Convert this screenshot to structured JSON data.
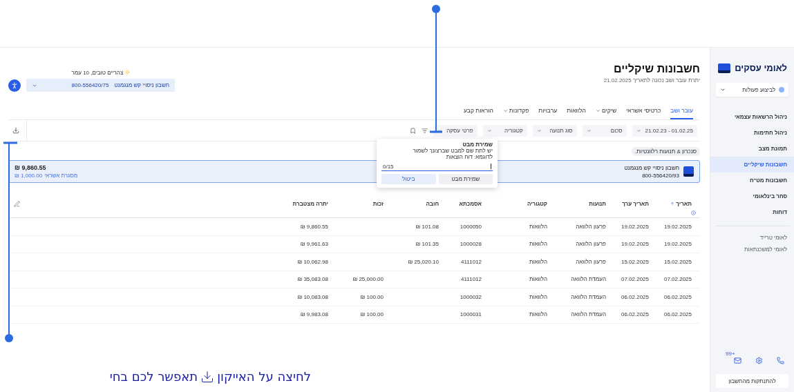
{
  "header": {
    "title": "חשבונות שיקליים",
    "subtitle": "יתרת עובר ושב נכונה לתאריך 21.02.2025",
    "greeting": "צהריים טובים, 10 עמר",
    "account_name": "חשבון ניסויי קש מנגמנט",
    "account_number": "800-556420/75"
  },
  "tabs": [
    {
      "label": "עובר ושב",
      "selected": true,
      "dropdown": false
    },
    {
      "label": "כרטיסי אשראי",
      "selected": false,
      "dropdown": false
    },
    {
      "label": "שיקים",
      "selected": false,
      "dropdown": true
    },
    {
      "label": "הלוואות",
      "selected": false,
      "dropdown": false
    },
    {
      "label": "ערבויות",
      "selected": false,
      "dropdown": false
    },
    {
      "label": "פקדונות",
      "selected": false,
      "dropdown": true
    },
    {
      "label": "הוראות קבע",
      "selected": false,
      "dropdown": false
    }
  ],
  "filters": [
    {
      "label": "21.02.23 - 01.02.25"
    },
    {
      "label": "סכום"
    },
    {
      "label": "סוג תנועה"
    },
    {
      "label": "קטגוריה"
    },
    {
      "label": "פרטי עסקה"
    }
  ],
  "chip": "סנכרון & תנועות רלוונטיות.",
  "save_view_popup": {
    "title": "שמירת מבט",
    "text": "יש לתת שם למבט שברצונך לשמור",
    "hint": "לדוגמא: דוח הוצאות",
    "counter": "0/15",
    "buttons": [
      "שמירת מבט",
      "ביטול"
    ]
  },
  "account_card": {
    "name": "חשבון ניסויי קש מנגמנט",
    "number": "800-556420/93",
    "balance": "₪ 9,860.55",
    "credit_label": "מסגרת אשראי",
    "credit_amount": "₪ 1,000.00"
  },
  "table": {
    "columns": [
      {
        "label": "תאריך",
        "sorted": true
      },
      {
        "label": "תאריך ערך",
        "sorted": false
      },
      {
        "label": "תנועות",
        "sorted": false
      },
      {
        "label": "קטגוריה",
        "sorted": false
      },
      {
        "label": "אסמכתא",
        "sorted": false
      },
      {
        "label": "חובה",
        "sorted": false
      },
      {
        "label": "זכות",
        "sorted": false
      },
      {
        "label": "יתרה מצטברת",
        "sorted": false
      }
    ],
    "rows": [
      {
        "date": "19.02.2025",
        "value_date": "19.02.2025",
        "description": "פרעון הלוואה",
        "category": "הלוואות",
        "reference": "1000050",
        "debit": "₪ 101.08",
        "balance": "₪ 9,860.55"
      },
      {
        "date": "19.02.2025",
        "value_date": "19.02.2025",
        "description": "פרעון הלוואה",
        "category": "הלוואות",
        "reference": "1000028",
        "debit": "₪ 101.35",
        "balance": "₪ 9,961.63"
      },
      {
        "date": "15.02.2025",
        "value_date": "15.02.2025",
        "description": "פרעון הלוואה",
        "category": "הלוואות",
        "reference": "4111012",
        "debit": "₪ 25,020.10",
        "balance": "₪ 10,062.98"
      },
      {
        "date": "07.02.2025",
        "value_date": "07.02.2025",
        "description": "העמדת הלוואה",
        "category": "הלוואות",
        "reference": "4111012",
        "credit": "₪ 25,000.00",
        "balance": "₪ 35,083.08"
      },
      {
        "date": "06.02.2025",
        "value_date": "06.02.2025",
        "description": "העמדת הלוואה",
        "category": "הלוואות",
        "reference": "1000032",
        "credit": "₪ 100.00",
        "balance": "₪ 10,083.08"
      },
      {
        "date": "06.02.2025",
        "value_date": "06.02.2025",
        "description": "העמדת הלוואה",
        "category": "הלוואות",
        "reference": "1000031",
        "credit": "₪ 100.00",
        "balance": "₪ 9,983.08"
      }
    ]
  },
  "sidebar": {
    "logo": "לאומי עסקים",
    "action_select": "לביצוע פעולות",
    "items": [
      {
        "label": "ניהול הרשאות עצמאי",
        "selected": false
      },
      {
        "label": "ניהול חתימות",
        "selected": false
      },
      {
        "label": "תמונת מצב",
        "selected": false
      },
      {
        "label": "חשבונות שיקליים",
        "selected": true
      },
      {
        "label": "חשבונות מט\"ח",
        "selected": false
      },
      {
        "label": "סחר בינלאומי",
        "selected": false
      },
      {
        "label": "דוחות",
        "selected": false
      }
    ],
    "links": [
      "לאומי טרייד",
      "לאומי למשכנתאות"
    ],
    "mail_badge": "+99",
    "logout": "להתנתקות מהחשבון"
  },
  "callout": {
    "before": "לחיצה על האייקון",
    "after": "תאפשר לכם בחי"
  }
}
